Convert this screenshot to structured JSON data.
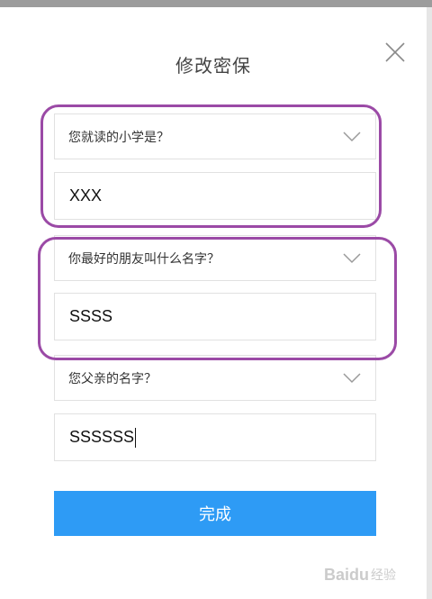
{
  "dialog": {
    "title": "修改密保",
    "close_icon": "close-icon"
  },
  "questions": [
    {
      "question": "您就读的小学是？",
      "answer": "XXX"
    },
    {
      "question": "你最好的朋友叫什么名字？",
      "answer": "SSSS"
    },
    {
      "question": "您父亲的名字？",
      "answer": "SSSSSS"
    }
  ],
  "actions": {
    "done_label": "完成"
  },
  "watermark": {
    "brand": "Baidu",
    "suffix": "经验"
  },
  "colors": {
    "accent": "#2e9bf5",
    "highlight": "#9b4aa6",
    "border": "#e1e1e1"
  }
}
